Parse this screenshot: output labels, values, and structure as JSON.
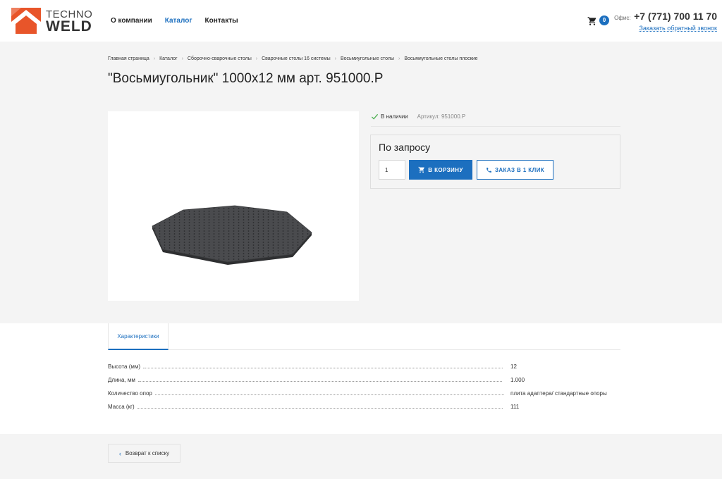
{
  "header": {
    "logo_line1": "TECHNO",
    "logo_line2": "WELD",
    "nav": [
      {
        "label": "О компании",
        "active": false
      },
      {
        "label": "Каталог",
        "active": true
      },
      {
        "label": "Контакты",
        "active": false
      }
    ],
    "cart_count": "0",
    "phone_label": "Офис:",
    "phone_number": "+7 (771) 700 11 70",
    "callback_label": "Заказать обратный звонок"
  },
  "breadcrumbs": [
    "Главная страница",
    "Каталог",
    "Сборочно-сварочные столы",
    "Сварочные столы 16 системы",
    "Восьмиугольные столы",
    "Восьмиугольные столы плоские"
  ],
  "product": {
    "title": "\"Восьмиугольник\" 1000x12 мм арт. 951000.P",
    "in_stock": "В наличии",
    "article": "Артикул: 951000.P",
    "price": "По запросу",
    "quantity": "1",
    "add_to_cart": "В КОРЗИНУ",
    "one_click": "ЗАКАЗ В 1 КЛИК"
  },
  "tabs": [
    {
      "label": "Характеристики"
    }
  ],
  "specs": [
    {
      "name": "Высота (мм)",
      "value": "12"
    },
    {
      "name": "Длина, мм",
      "value": "1.000"
    },
    {
      "name": "Количество опор",
      "value": "плита адаптера/ стандартные опоры"
    },
    {
      "name": "Масса (кг)",
      "value": "111"
    }
  ],
  "back_label": "Возврат к списку",
  "colors": {
    "accent": "#1c6fbf",
    "logo_orange": "#e8552a"
  },
  "icons": {
    "cart": "cart-icon",
    "check": "check-icon",
    "phone": "phone-icon",
    "back": "chevron-left-icon"
  }
}
